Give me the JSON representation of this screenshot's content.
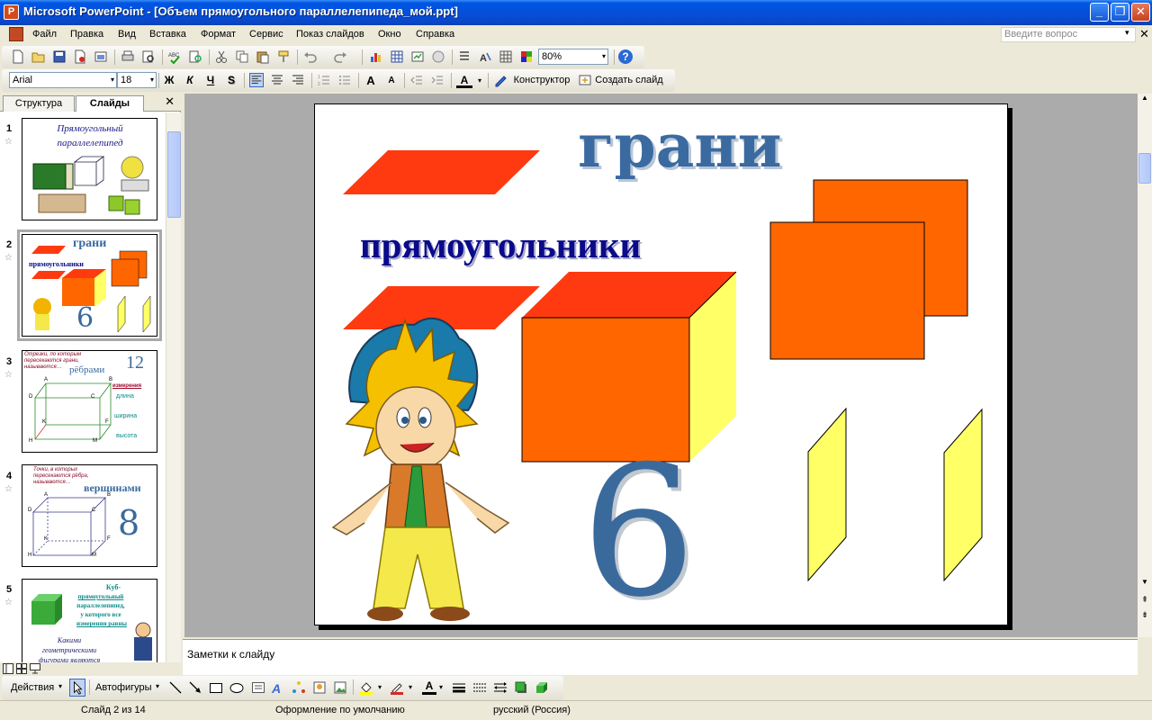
{
  "window": {
    "title": "Microsoft PowerPoint - [Объем прямоугольного параллелепипеда_мой.ppt]",
    "app_icon_glyph": "P",
    "minimize_glyph": "_",
    "maximize_glyph": "❐",
    "close_glyph": "✕"
  },
  "menu": {
    "items": [
      "Файл",
      "Правка",
      "Вид",
      "Вставка",
      "Формат",
      "Сервис",
      "Показ слайдов",
      "Окно",
      "Справка"
    ],
    "ask_placeholder": "Введите вопрос",
    "ask_arrow": "▾",
    "close_glyph": "✕"
  },
  "toolbar_standard": {
    "zoom": "80%",
    "zoom_arrow": "▾",
    "help_glyph": "?"
  },
  "toolbar_format": {
    "font_name": "Arial",
    "font_size": "18",
    "bold": "Ж",
    "italic": "К",
    "underline": "Ч",
    "shadow": "S",
    "grow_font": "A",
    "shrink_font": "A",
    "font_color": "A",
    "designer": "Конструктор",
    "new_slide": "Создать слайд",
    "arrow": "▾"
  },
  "pane": {
    "tab_outline": "Структура",
    "tab_slides": "Слайды",
    "close_glyph": "✕",
    "star_glyph": "☆",
    "slides": [
      {
        "num": "1",
        "title": "Прямоугольный параллелепипед"
      },
      {
        "num": "2",
        "title": "грани",
        "subtitle": "прямоугольники",
        "count": "6"
      },
      {
        "num": "3",
        "caption": "Отрезки, по которым пересекаются грани, называются…",
        "title": "рёбрами",
        "count": "12",
        "dimensions_label": "измерения",
        "dims": [
          "длина",
          "ширина",
          "высота"
        ],
        "vertices": [
          "A",
          "B",
          "C",
          "D",
          "K",
          "F",
          "H",
          "M"
        ]
      },
      {
        "num": "4",
        "caption": "Точки, в которых пересекаются рёбра, называются…",
        "title": "вершинами",
        "count": "8",
        "vertices": [
          "A",
          "B",
          "C",
          "D",
          "K",
          "F",
          "H",
          "M"
        ]
      },
      {
        "num": "5",
        "title": "Куб-",
        "lines": [
          "прямоугольный",
          "параллелепипед,",
          "у которого все",
          "измерения равны"
        ],
        "question": "Какими геометрическими фигурами являются"
      }
    ]
  },
  "slide": {
    "title": "грани",
    "subtitle": "прямоугольники",
    "count": "6",
    "colors": {
      "title": "#3a6aa0",
      "subtitle": "#0a0a8a",
      "face_red": "#ff3a10",
      "face_orange": "#ff6600",
      "face_yellow": "#ffff66",
      "count": "#3a6a9c"
    }
  },
  "notes": {
    "placeholder": "Заметки к слайду"
  },
  "drawing": {
    "actions": "Действия",
    "autoshapes": "Автофигуры",
    "arrow": "▾"
  },
  "status": {
    "slide_pos": "Слайд 2 из 14",
    "design": "Оформление по умолчанию",
    "language": "русский (Россия)"
  },
  "scroll": {
    "up": "▲",
    "down": "▼",
    "prev": "⇞",
    "next": "⇟"
  }
}
